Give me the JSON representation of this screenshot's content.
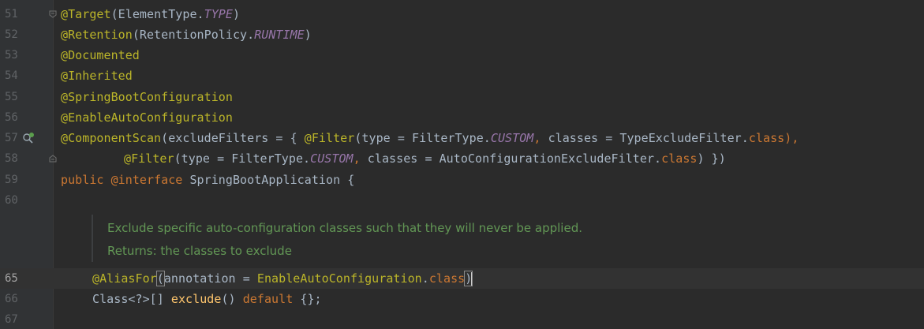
{
  "editor": {
    "line_numbers": [
      "51",
      "52",
      "53",
      "54",
      "55",
      "56",
      "57",
      "58",
      "59",
      "60",
      "65",
      "66",
      "67"
    ],
    "code": {
      "l51": {
        "a": "@Target",
        "b": "(ElementType.",
        "c": "TYPE",
        "d": ")"
      },
      "l52": {
        "a": "@Retention",
        "b": "(RetentionPolicy.",
        "c": "RUNTIME",
        "d": ")"
      },
      "l53": {
        "a": "@Documented"
      },
      "l54": {
        "a": "@Inherited"
      },
      "l55": {
        "a": "@SpringBootConfiguration"
      },
      "l56": {
        "a": "@EnableAutoConfiguration"
      },
      "l57": {
        "a": "@ComponentScan",
        "b": "(excludeFilters = { ",
        "c": "@Filter",
        "d": "(type = FilterType.",
        "e": "CUSTOM",
        "f": ", ",
        "g": "classes = TypeExcludeFilter.",
        "h": "class",
        "i": "),"
      },
      "l58": {
        "a": "@Filter",
        "b": "(type = FilterType.",
        "c": "CUSTOM",
        "d": ", ",
        "e": "classes = AutoConfigurationExcludeFilter.",
        "f": "class",
        "g": ") })"
      },
      "l59": {
        "a": "public ",
        "b": "@interface",
        "c": " SpringBootApplication {"
      },
      "l65": {
        "a": "@AliasFor",
        "b": "(",
        "c": "annotation = ",
        "d": "EnableAutoConfiguration",
        "e": ".",
        "f": "class",
        "g": ")"
      },
      "l66": {
        "a": "Class<?>[] ",
        "b": "exclude",
        "c": "() ",
        "d": "default",
        "e": " {};"
      }
    },
    "doc_comment": {
      "line1": "Exclude specific auto-configuration classes such that they will never be applied.",
      "line2": "Returns: the classes to exclude"
    },
    "icons": {
      "fold": "fold-marker-icon",
      "bean": "spring-bean-search-icon"
    },
    "colors": {
      "background": "#2b2b2b",
      "annotation": "#bbb529",
      "keyword": "#cc7832",
      "constant": "#9876aa",
      "method": "#ffc66d",
      "doc_comment": "#629755"
    }
  }
}
